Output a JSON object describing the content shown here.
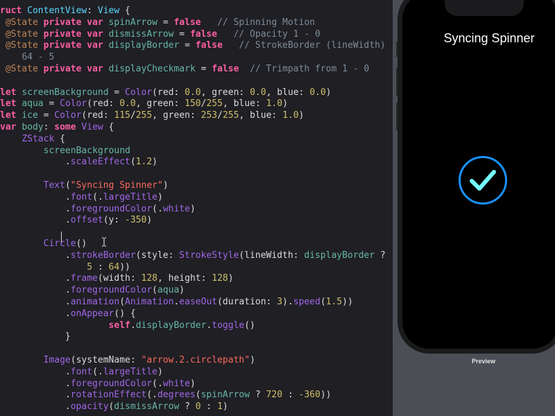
{
  "accent": "#1a91ff",
  "check_color": "#73fdff",
  "editor": {
    "theme": {
      "kw": "#fc5fa3",
      "type": "#5dd8ff",
      "plain": "#dcdcdc",
      "prop": "#a167e6",
      "str": "#fc6a5d",
      "num": "#d0bf69",
      "cmt": "#7f8c98",
      "loc": "#67b7a4",
      "attr": "#bf8555"
    },
    "lines": [
      [
        [
          "kw",
          "ruct "
        ],
        [
          "type",
          "ContentView"
        ],
        [
          "plain",
          ": "
        ],
        [
          "type",
          "View"
        ],
        [
          "plain",
          " {"
        ]
      ],
      [
        [
          "plain",
          " "
        ],
        [
          "attr",
          "@State"
        ],
        [
          "plain",
          " "
        ],
        [
          "kw",
          "private var"
        ],
        [
          "plain",
          " "
        ],
        [
          "loc",
          "spinArrow"
        ],
        [
          "plain",
          " = "
        ],
        [
          "kw",
          "false"
        ],
        [
          "plain",
          "   "
        ],
        [
          "cmt",
          "// Spinning Motion"
        ]
      ],
      [
        [
          "plain",
          " "
        ],
        [
          "attr",
          "@State"
        ],
        [
          "plain",
          " "
        ],
        [
          "kw",
          "private var"
        ],
        [
          "plain",
          " "
        ],
        [
          "loc",
          "dismissArrow"
        ],
        [
          "plain",
          " = "
        ],
        [
          "kw",
          "false"
        ],
        [
          "plain",
          "   "
        ],
        [
          "cmt",
          "// Opacity 1 - 0"
        ]
      ],
      [
        [
          "plain",
          " "
        ],
        [
          "attr",
          "@State"
        ],
        [
          "plain",
          " "
        ],
        [
          "kw",
          "private var"
        ],
        [
          "plain",
          " "
        ],
        [
          "loc",
          "displayBorder"
        ],
        [
          "plain",
          " = "
        ],
        [
          "kw",
          "false"
        ],
        [
          "plain",
          "   "
        ],
        [
          "cmt",
          "// StrokeBorder (lineWidth)"
        ]
      ],
      [
        [
          "plain",
          "    "
        ],
        [
          "cmt",
          "64 - 5"
        ]
      ],
      [
        [
          "plain",
          " "
        ],
        [
          "attr",
          "@State"
        ],
        [
          "plain",
          " "
        ],
        [
          "kw",
          "private var"
        ],
        [
          "plain",
          " "
        ],
        [
          "loc",
          "displayCheckmark"
        ],
        [
          "plain",
          " = "
        ],
        [
          "kw",
          "false"
        ],
        [
          "plain",
          "  "
        ],
        [
          "cmt",
          "// Trimpath from 1 - 0"
        ]
      ],
      [],
      [
        [
          "kw",
          "let"
        ],
        [
          "plain",
          " "
        ],
        [
          "loc",
          "screenBackground"
        ],
        [
          "plain",
          " = "
        ],
        [
          "prop",
          "Color"
        ],
        [
          "plain",
          "(red: "
        ],
        [
          "num",
          "0.0"
        ],
        [
          "plain",
          ", green: "
        ],
        [
          "num",
          "0.0"
        ],
        [
          "plain",
          ", blue: "
        ],
        [
          "num",
          "0.0"
        ],
        [
          "plain",
          ")"
        ]
      ],
      [
        [
          "kw",
          "let"
        ],
        [
          "plain",
          " "
        ],
        [
          "loc",
          "aqua"
        ],
        [
          "plain",
          " = "
        ],
        [
          "prop",
          "Color"
        ],
        [
          "plain",
          "(red: "
        ],
        [
          "num",
          "0.0"
        ],
        [
          "plain",
          ", green: "
        ],
        [
          "num",
          "150"
        ],
        [
          "plain",
          "/"
        ],
        [
          "num",
          "255"
        ],
        [
          "plain",
          ", blue: "
        ],
        [
          "num",
          "1.0"
        ],
        [
          "plain",
          ")"
        ]
      ],
      [
        [
          "kw",
          "let"
        ],
        [
          "plain",
          " "
        ],
        [
          "loc",
          "ice"
        ],
        [
          "plain",
          " = "
        ],
        [
          "prop",
          "Color"
        ],
        [
          "plain",
          "(red: "
        ],
        [
          "num",
          "115"
        ],
        [
          "plain",
          "/"
        ],
        [
          "num",
          "255"
        ],
        [
          "plain",
          ", green: "
        ],
        [
          "num",
          "253"
        ],
        [
          "plain",
          "/"
        ],
        [
          "num",
          "255"
        ],
        [
          "plain",
          ", blue: "
        ],
        [
          "num",
          "1.0"
        ],
        [
          "plain",
          ")"
        ]
      ],
      [
        [
          "kw",
          "var"
        ],
        [
          "plain",
          " "
        ],
        [
          "loc",
          "body"
        ],
        [
          "plain",
          ": "
        ],
        [
          "kw",
          "some"
        ],
        [
          "plain",
          " "
        ],
        [
          "prop",
          "View"
        ],
        [
          "plain",
          " {"
        ]
      ],
      [
        [
          "plain",
          "    "
        ],
        [
          "prop",
          "ZStack"
        ],
        [
          "plain",
          " {"
        ]
      ],
      [
        [
          "plain",
          "        "
        ],
        [
          "loc",
          "screenBackground"
        ]
      ],
      [
        [
          "plain",
          "            ."
        ],
        [
          "prop",
          "scaleEffect"
        ],
        [
          "plain",
          "("
        ],
        [
          "num",
          "1.2"
        ],
        [
          "plain",
          ")"
        ]
      ],
      [],
      [
        [
          "plain",
          "        "
        ],
        [
          "prop",
          "Text"
        ],
        [
          "plain",
          "("
        ],
        [
          "str",
          "\"Syncing Spinner\""
        ],
        [
          "plain",
          ")"
        ]
      ],
      [
        [
          "plain",
          "            ."
        ],
        [
          "prop",
          "font"
        ],
        [
          "plain",
          "(."
        ],
        [
          "prop",
          "largeTitle"
        ],
        [
          "plain",
          ")"
        ]
      ],
      [
        [
          "plain",
          "            ."
        ],
        [
          "prop",
          "foregroundColor"
        ],
        [
          "plain",
          "(."
        ],
        [
          "prop",
          "white"
        ],
        [
          "plain",
          ")"
        ]
      ],
      [
        [
          "plain",
          "            ."
        ],
        [
          "prop",
          "offset"
        ],
        [
          "plain",
          "(y: "
        ],
        [
          "num",
          "-350"
        ],
        [
          "plain",
          ")"
        ]
      ],
      [],
      [
        [
          "plain",
          "        "
        ],
        [
          "prop",
          "Circle"
        ],
        [
          "plain",
          "()"
        ]
      ],
      [
        [
          "plain",
          "            ."
        ],
        [
          "prop",
          "strokeBorder"
        ],
        [
          "plain",
          "(style: "
        ],
        [
          "prop",
          "StrokeStyle"
        ],
        [
          "plain",
          "(lineWidth: "
        ],
        [
          "loc",
          "displayBorder"
        ],
        [
          "plain",
          " ?"
        ]
      ],
      [
        [
          "plain",
          "                "
        ],
        [
          "num",
          "5"
        ],
        [
          "plain",
          " : "
        ],
        [
          "num",
          "64"
        ],
        [
          "plain",
          "))"
        ]
      ],
      [
        [
          "plain",
          "            ."
        ],
        [
          "prop",
          "frame"
        ],
        [
          "plain",
          "(width: "
        ],
        [
          "num",
          "128"
        ],
        [
          "plain",
          ", height: "
        ],
        [
          "num",
          "128"
        ],
        [
          "plain",
          ")"
        ]
      ],
      [
        [
          "plain",
          "            ."
        ],
        [
          "prop",
          "foregroundColor"
        ],
        [
          "plain",
          "("
        ],
        [
          "loc",
          "aqua"
        ],
        [
          "plain",
          ")"
        ]
      ],
      [
        [
          "plain",
          "            ."
        ],
        [
          "prop",
          "animation"
        ],
        [
          "plain",
          "("
        ],
        [
          "prop",
          "Animation"
        ],
        [
          "plain",
          "."
        ],
        [
          "prop",
          "easeOut"
        ],
        [
          "plain",
          "(duration: "
        ],
        [
          "num",
          "3"
        ],
        [
          "plain",
          ")."
        ],
        [
          "prop",
          "speed"
        ],
        [
          "plain",
          "("
        ],
        [
          "num",
          "1.5"
        ],
        [
          "plain",
          "))"
        ]
      ],
      [
        [
          "plain",
          "            ."
        ],
        [
          "prop",
          "onAppear"
        ],
        [
          "plain",
          "() {"
        ]
      ],
      [
        [
          "plain",
          "                    "
        ],
        [
          "kw",
          "self"
        ],
        [
          "plain",
          "."
        ],
        [
          "loc",
          "displayBorder"
        ],
        [
          "plain",
          "."
        ],
        [
          "prop",
          "toggle"
        ],
        [
          "plain",
          "()"
        ]
      ],
      [
        [
          "plain",
          "            }"
        ]
      ],
      [],
      [
        [
          "plain",
          "        "
        ],
        [
          "prop",
          "Image"
        ],
        [
          "plain",
          "(systemName: "
        ],
        [
          "str",
          "\"arrow.2.circlepath\""
        ],
        [
          "plain",
          ")"
        ]
      ],
      [
        [
          "plain",
          "            ."
        ],
        [
          "prop",
          "font"
        ],
        [
          "plain",
          "(."
        ],
        [
          "prop",
          "largeTitle"
        ],
        [
          "plain",
          ")"
        ]
      ],
      [
        [
          "plain",
          "            ."
        ],
        [
          "prop",
          "foregroundColor"
        ],
        [
          "plain",
          "(."
        ],
        [
          "prop",
          "white"
        ],
        [
          "plain",
          ")"
        ]
      ],
      [
        [
          "plain",
          "            ."
        ],
        [
          "prop",
          "rotationEffect"
        ],
        [
          "plain",
          "(."
        ],
        [
          "prop",
          "degrees"
        ],
        [
          "plain",
          "("
        ],
        [
          "loc",
          "spinArrow"
        ],
        [
          "plain",
          " ? "
        ],
        [
          "num",
          "720"
        ],
        [
          "plain",
          " : "
        ],
        [
          "num",
          "-360"
        ],
        [
          "plain",
          "))"
        ]
      ],
      [
        [
          "plain",
          "            ."
        ],
        [
          "prop",
          "opacity"
        ],
        [
          "plain",
          "("
        ],
        [
          "loc",
          "dismissArrow"
        ],
        [
          "plain",
          " ? "
        ],
        [
          "num",
          "0"
        ],
        [
          "plain",
          " : "
        ],
        [
          "num",
          "1"
        ],
        [
          "plain",
          ")"
        ]
      ]
    ]
  },
  "preview": {
    "title": "Syncing Spinner",
    "label": "Preview"
  }
}
